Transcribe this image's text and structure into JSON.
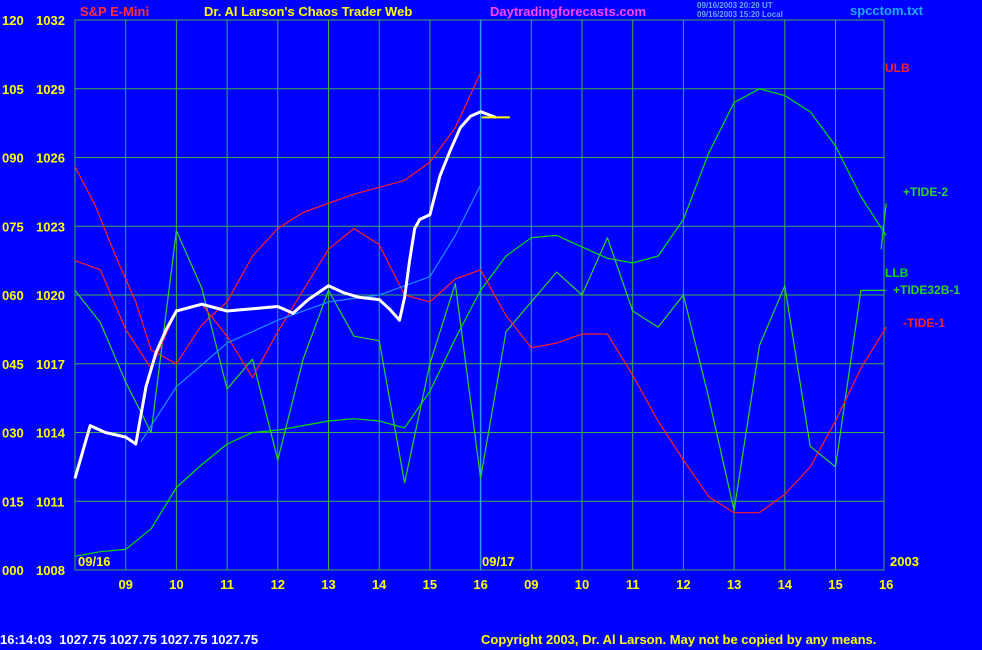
{
  "header": {
    "symbol": "S&P E-Mini",
    "title": "Dr. Al Larson's Chaos Trader Web",
    "website": "Daytradingforecasts.com",
    "timestamp_ut": "09/16/2003 20:20 UT",
    "timestamp_local": "09/16/2003 15:20 Local",
    "filename": "spcctom.txt"
  },
  "footer": {
    "quote": "16:14:03  1027.75 1027.75 1027.75 1027.75",
    "copyright": "Copyright 2003, Dr. Al Larson. May not be copied by any means."
  },
  "chart_data": {
    "type": "line",
    "title": "S&P E-Mini",
    "y_left_labels": [
      "120",
      "105",
      "090",
      "075",
      "060",
      "045",
      "030",
      "015",
      "000"
    ],
    "y_price_labels": [
      "1032",
      "1029",
      "1026",
      "1023",
      "1020",
      "1017",
      "1014",
      "1011",
      "1008"
    ],
    "ylim_price": [
      1008,
      1032
    ],
    "ylim_tide": [
      0,
      120
    ],
    "x_tick_labels": [
      "09",
      "10",
      "11",
      "12",
      "13",
      "14",
      "15",
      "16",
      "09",
      "10",
      "11",
      "12",
      "13",
      "14",
      "15",
      "16"
    ],
    "date_labels": [
      "09/16",
      "09/17",
      "2003"
    ],
    "grid": true,
    "colors": {
      "background": "#0000FF",
      "grid": "#3CB043",
      "axis_text": "#FFFF00",
      "ulb": "#FF2020",
      "llb": "#00E000",
      "tide32b": "#2BD42B",
      "tide1": "#FF2020",
      "midline": "#1E90FF",
      "price": "#FFFFFF"
    },
    "series": [
      {
        "name": "ULB",
        "label_color": "#FF2020",
        "x": [
          8.0,
          8.4,
          8.8,
          9.2,
          9.5,
          10.0,
          10.5,
          11.0,
          11.5,
          12.0,
          12.5,
          13.0,
          13.5,
          14.0,
          14.5,
          15.0,
          15.5,
          16.0
        ],
        "y": [
          1025.6,
          1023.9,
          1021.7,
          1019.7,
          1017.6,
          1017.0,
          1018.7,
          1019.7,
          1021.7,
          1022.9,
          1023.6,
          1024.0,
          1024.4,
          1024.7,
          1025.0,
          1025.8,
          1027.3,
          1029.7
        ]
      },
      {
        "name": "LLB",
        "label_color": "#00E000",
        "x": [
          8.0,
          8.5,
          9.0,
          9.5,
          10.0,
          10.5,
          11.0,
          11.5,
          12.0,
          12.5,
          13.0,
          13.5,
          14.0,
          14.5,
          15.0,
          15.5,
          16.0,
          16.5,
          17.0,
          17.5,
          18.0,
          18.5,
          19.0,
          19.5,
          20.0,
          20.5,
          21.0,
          21.5,
          22.0,
          22.5,
          23.0,
          23.5,
          24.0
        ],
        "y": [
          1008.6,
          1008.8,
          1008.9,
          1009.8,
          1011.6,
          1012.6,
          1013.5,
          1014.0,
          1014.1,
          1014.3,
          1014.5,
          1014.6,
          1014.5,
          1014.2,
          1015.8,
          1018.1,
          1020.2,
          1021.7,
          1022.5,
          1022.6,
          1022.1,
          1021.6,
          1021.4,
          1021.7,
          1023.3,
          1026.2,
          1028.4,
          1029.0,
          1028.7,
          1028.0,
          1026.5,
          1024.3,
          1022.6
        ]
      },
      {
        "name": "+TIDE32B-1",
        "label_color": "#2BD42B",
        "x": [
          8.0,
          8.5,
          9.0,
          9.5,
          10.0,
          10.5,
          11.0,
          11.5,
          12.0,
          12.5,
          13.0,
          13.5,
          14.0,
          14.5,
          15.0,
          15.5,
          16.0,
          16.5,
          17.0,
          17.5,
          18.0,
          18.5,
          19.0,
          19.5,
          20.0,
          20.5,
          21.0,
          21.5,
          22.0,
          22.5,
          23.0,
          23.5,
          24.0
        ],
        "y": [
          1020.2,
          1018.8,
          1016.2,
          1014.0,
          1022.8,
          1020.3,
          1015.9,
          1017.2,
          1012.8,
          1017.2,
          1020.2,
          1018.2,
          1018.0,
          1011.8,
          1017.0,
          1020.5,
          1012.0,
          1018.4,
          1019.7,
          1021.0,
          1020.0,
          1022.5,
          1019.3,
          1018.6,
          1020.0,
          1015.5,
          1010.6,
          1017.8,
          1020.4,
          1013.4,
          1012.5,
          1020.2,
          1020.2
        ]
      },
      {
        "name": "-TIDE-1",
        "label_color": "#FF2020",
        "x": [
          8.0,
          8.5,
          9.0,
          9.5,
          10.0,
          10.5,
          11.0,
          11.5,
          12.0,
          12.5,
          13.0,
          13.5,
          14.0,
          14.5,
          15.0,
          15.5,
          16.0,
          16.5,
          17.0,
          17.5,
          18.0,
          18.5,
          19.0,
          19.5,
          20.0,
          20.5,
          21.0,
          21.5,
          22.0,
          22.5,
          23.0,
          23.5,
          24.0
        ],
        "y": [
          1021.5,
          1021.1,
          1018.5,
          1016.8,
          1019.3,
          1019.6,
          1018.2,
          1016.4,
          1018.4,
          1020.2,
          1022.0,
          1022.9,
          1022.2,
          1020.0,
          1019.7,
          1020.7,
          1021.1,
          1019.1,
          1017.7,
          1017.9,
          1018.3,
          1018.3,
          1016.5,
          1014.5,
          1012.8,
          1011.2,
          1010.5,
          1010.5,
          1011.3,
          1012.5,
          1014.5,
          1016.8,
          1018.6
        ]
      },
      {
        "name": "+TIDE-2",
        "label_color": "#2BD42B",
        "x": [
          23.9,
          24.0
        ],
        "y": [
          1022.0,
          1024.0
        ]
      },
      {
        "name": "midline",
        "x": [
          9.3,
          10.0,
          11.0,
          12.0,
          13.0,
          14.0,
          15.0,
          15.5,
          16.0
        ],
        "y": [
          1013.6,
          1016.0,
          1017.9,
          1018.9,
          1019.7,
          1020.0,
          1020.8,
          1022.6,
          1024.8
        ]
      },
      {
        "name": "price",
        "x": [
          8.0,
          8.3,
          8.6,
          9.0,
          9.2,
          9.4,
          9.6,
          9.8,
          10.0,
          10.5,
          11.0,
          11.5,
          12.0,
          12.3,
          12.6,
          13.0,
          13.3,
          13.6,
          14.0,
          14.2,
          14.4,
          14.5,
          14.6,
          14.7,
          14.8,
          15.0,
          15.2,
          15.4,
          15.6,
          15.8,
          16.0,
          16.3
        ],
        "y": [
          1012.0,
          1014.3,
          1014.0,
          1013.8,
          1013.5,
          1016.0,
          1017.5,
          1018.5,
          1019.3,
          1019.6,
          1019.3,
          1019.4,
          1019.5,
          1019.2,
          1019.8,
          1020.4,
          1020.1,
          1019.9,
          1019.8,
          1019.4,
          1018.9,
          1019.9,
          1021.5,
          1022.9,
          1023.3,
          1023.5,
          1025.2,
          1026.3,
          1027.3,
          1027.8,
          1028.0,
          1027.75
        ]
      }
    ]
  }
}
